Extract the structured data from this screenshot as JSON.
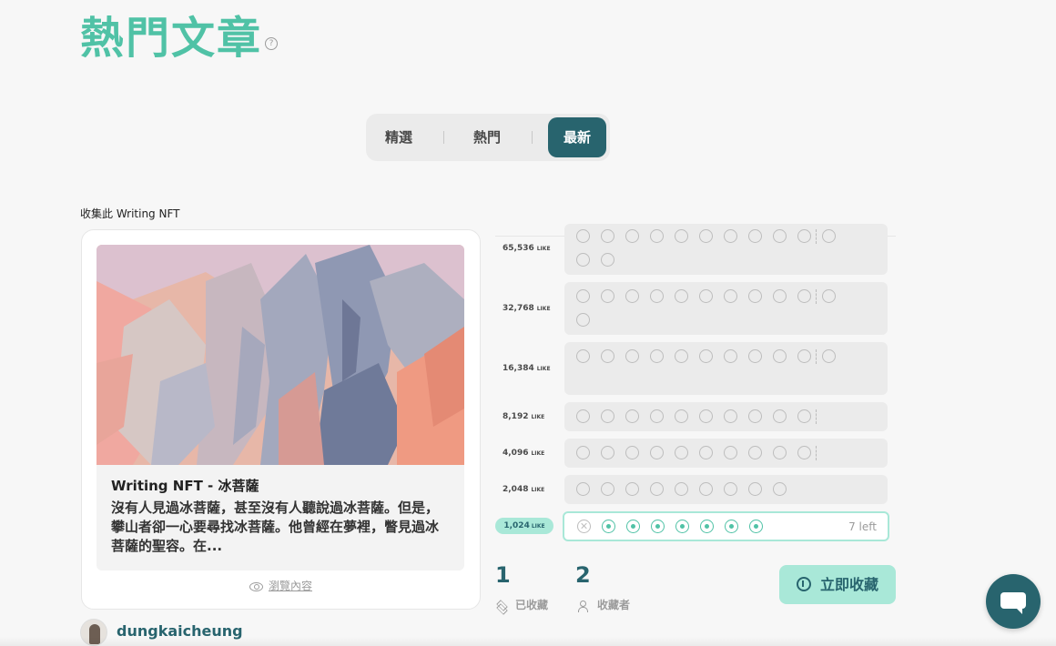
{
  "page": {
    "title": "熱門文章",
    "help_icon": "?"
  },
  "tabs": [
    {
      "label": "精選",
      "active": false
    },
    {
      "label": "熱門",
      "active": false
    },
    {
      "label": "最新",
      "active": true
    }
  ],
  "nft": {
    "collect_label": "收集此 Writing NFT",
    "card_title": "Writing NFT - 冰菩薩",
    "card_excerpt": "沒有人見過冰菩薩，甚至沒有人聽說過冰菩薩。但是，攀山者卻一心要尋找冰菩薩。他曾經在夢裡，瞥見過冰菩薩的聖容。在...",
    "preview_label": "瀏覽內容",
    "author_name": "dungkaicheung"
  },
  "like_tiers": {
    "unit": "LIKE",
    "rows": [
      {
        "price": "65,536",
        "slots": 13
      },
      {
        "price": "32,768",
        "slots": 12
      },
      {
        "price": "16,384",
        "slots": 11
      },
      {
        "price": "8,192",
        "slots": 10
      },
      {
        "price": "4,096",
        "slots": 10
      },
      {
        "price": "2,048",
        "slots": 9
      }
    ],
    "active_row": {
      "price": "1,024",
      "sold": 1,
      "remaining": 7,
      "left_label": "7 left"
    }
  },
  "stats": {
    "collected_count": "1",
    "collected_label": "已收藏",
    "collectors_count": "2",
    "collectors_label": "收藏者"
  },
  "collect_button_label": "立即收藏",
  "colors": {
    "brand_green": "#50c2a6",
    "dark_teal": "#28646e",
    "light_mint": "#a9e8d8"
  }
}
